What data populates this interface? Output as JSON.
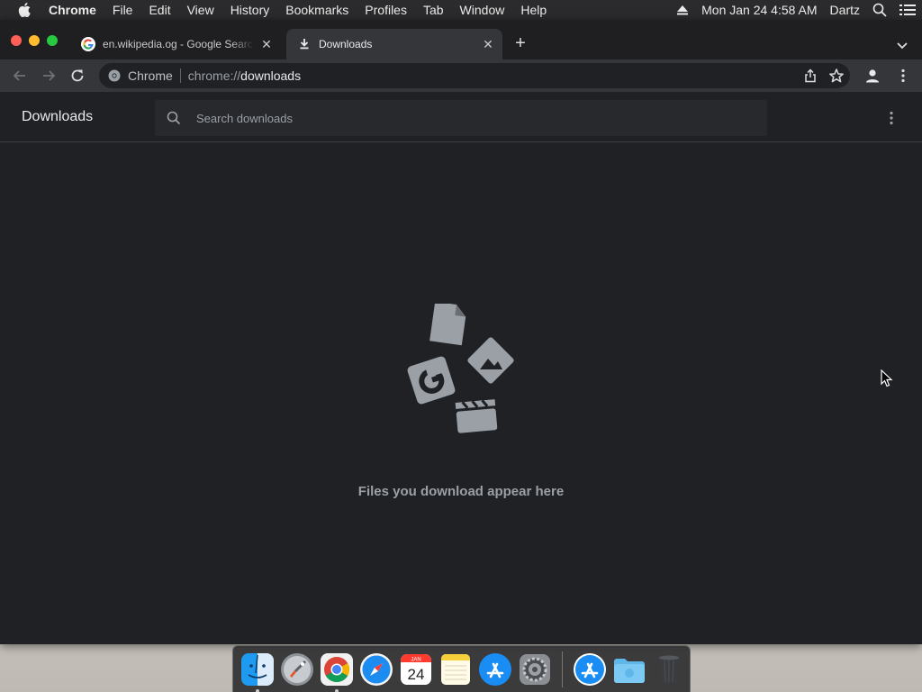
{
  "menubar": {
    "app_name": "Chrome",
    "items": [
      "File",
      "Edit",
      "View",
      "History",
      "Bookmarks",
      "Profiles",
      "Tab",
      "Window",
      "Help"
    ],
    "datetime": "Mon Jan 24  4:58 AM",
    "user": "Dartz"
  },
  "tabs": [
    {
      "title": "en.wikipedia.og - Google Search",
      "icon": "google-icon",
      "active": false
    },
    {
      "title": "Downloads",
      "icon": "download-icon",
      "active": true
    }
  ],
  "toolbar": {
    "site_chip": "Chrome",
    "url_scheme": "chrome://",
    "url_host": "downloads"
  },
  "page": {
    "title": "Downloads",
    "search_placeholder": "Search downloads",
    "empty_message": "Files you download appear here"
  },
  "dock": {
    "calendar_month": "JAN",
    "calendar_day": "24",
    "apps": [
      "finder-icon",
      "launchpad-icon",
      "chrome-icon",
      "safari-icon",
      "calendar-icon",
      "notes-icon",
      "app-store-icon",
      "system-preferences-icon",
      "app-store-icon",
      "downloads-folder-icon",
      "trash-icon"
    ]
  },
  "colors": {
    "window_bg": "#202124",
    "toolbar_bg": "#35363a",
    "text_primary": "#e8eaed",
    "text_secondary": "#9aa0a6",
    "illustration": "#9aa0a6"
  }
}
